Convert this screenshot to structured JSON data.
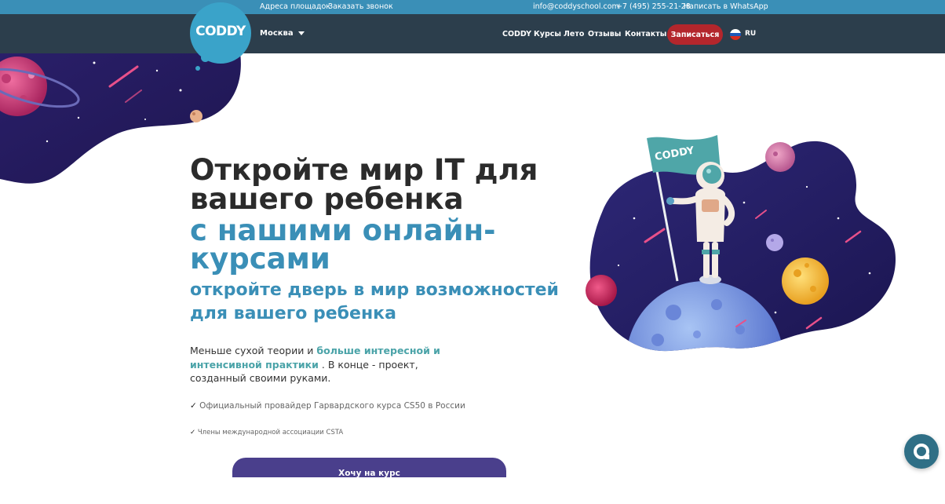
{
  "topbar": {
    "address_link": "Адреса площадок",
    "callback_link": "Заказать звонок",
    "email": "info@coddyschool.com",
    "phone": "+7 (495) 255-21-28",
    "whatsapp_link": "Написать в WhatsApp"
  },
  "nav": {
    "logo": "CODDY",
    "city": "Москва",
    "links": [
      "CODDY",
      "Курсы",
      "Лето",
      "Отзывы",
      "Контакты"
    ],
    "signup_button": "Записаться",
    "language": "RU"
  },
  "hero": {
    "title": "Откройте мир IT для вашего ребенка",
    "title_accent": "с нашими онлайн-курсами",
    "subtitle": "откройте дверь в мир возможностей для вашего ребенка",
    "desc_part1": "Меньше сухой теории и ",
    "desc_highlight": "больше интересной и интенсивной практики",
    "desc_part2": " . В конце - проект, созданный своими руками.",
    "check_mark": "✓",
    "check1": " Официальный провайдер Гарвардского курса CS50 в России",
    "check2": " Члены международной ассоциации CSTA",
    "cta_button": "Хочу на курс",
    "flag_text": "CODDY"
  },
  "colors": {
    "topbar": "#3a8fb7",
    "navbar": "#2c3e4c",
    "accent": "#3a8fb7",
    "signup": "#b3262c",
    "cta": "#4a3f8c",
    "space": "#2a2470"
  }
}
